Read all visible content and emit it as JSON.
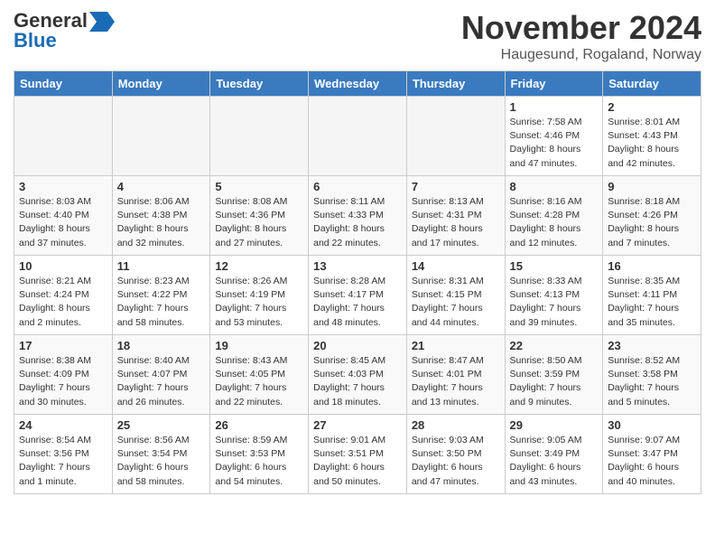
{
  "logo": {
    "line1": "General",
    "line2": "Blue"
  },
  "title": "November 2024",
  "location": "Haugesund, Rogaland, Norway",
  "headers": [
    "Sunday",
    "Monday",
    "Tuesday",
    "Wednesday",
    "Thursday",
    "Friday",
    "Saturday"
  ],
  "weeks": [
    [
      {
        "day": "",
        "info": ""
      },
      {
        "day": "",
        "info": ""
      },
      {
        "day": "",
        "info": ""
      },
      {
        "day": "",
        "info": ""
      },
      {
        "day": "",
        "info": ""
      },
      {
        "day": "1",
        "info": "Sunrise: 7:58 AM\nSunset: 4:46 PM\nDaylight: 8 hours\nand 47 minutes."
      },
      {
        "day": "2",
        "info": "Sunrise: 8:01 AM\nSunset: 4:43 PM\nDaylight: 8 hours\nand 42 minutes."
      }
    ],
    [
      {
        "day": "3",
        "info": "Sunrise: 8:03 AM\nSunset: 4:40 PM\nDaylight: 8 hours\nand 37 minutes."
      },
      {
        "day": "4",
        "info": "Sunrise: 8:06 AM\nSunset: 4:38 PM\nDaylight: 8 hours\nand 32 minutes."
      },
      {
        "day": "5",
        "info": "Sunrise: 8:08 AM\nSunset: 4:36 PM\nDaylight: 8 hours\nand 27 minutes."
      },
      {
        "day": "6",
        "info": "Sunrise: 8:11 AM\nSunset: 4:33 PM\nDaylight: 8 hours\nand 22 minutes."
      },
      {
        "day": "7",
        "info": "Sunrise: 8:13 AM\nSunset: 4:31 PM\nDaylight: 8 hours\nand 17 minutes."
      },
      {
        "day": "8",
        "info": "Sunrise: 8:16 AM\nSunset: 4:28 PM\nDaylight: 8 hours\nand 12 minutes."
      },
      {
        "day": "9",
        "info": "Sunrise: 8:18 AM\nSunset: 4:26 PM\nDaylight: 8 hours\nand 7 minutes."
      }
    ],
    [
      {
        "day": "10",
        "info": "Sunrise: 8:21 AM\nSunset: 4:24 PM\nDaylight: 8 hours\nand 2 minutes."
      },
      {
        "day": "11",
        "info": "Sunrise: 8:23 AM\nSunset: 4:22 PM\nDaylight: 7 hours\nand 58 minutes."
      },
      {
        "day": "12",
        "info": "Sunrise: 8:26 AM\nSunset: 4:19 PM\nDaylight: 7 hours\nand 53 minutes."
      },
      {
        "day": "13",
        "info": "Sunrise: 8:28 AM\nSunset: 4:17 PM\nDaylight: 7 hours\nand 48 minutes."
      },
      {
        "day": "14",
        "info": "Sunrise: 8:31 AM\nSunset: 4:15 PM\nDaylight: 7 hours\nand 44 minutes."
      },
      {
        "day": "15",
        "info": "Sunrise: 8:33 AM\nSunset: 4:13 PM\nDaylight: 7 hours\nand 39 minutes."
      },
      {
        "day": "16",
        "info": "Sunrise: 8:35 AM\nSunset: 4:11 PM\nDaylight: 7 hours\nand 35 minutes."
      }
    ],
    [
      {
        "day": "17",
        "info": "Sunrise: 8:38 AM\nSunset: 4:09 PM\nDaylight: 7 hours\nand 30 minutes."
      },
      {
        "day": "18",
        "info": "Sunrise: 8:40 AM\nSunset: 4:07 PM\nDaylight: 7 hours\nand 26 minutes."
      },
      {
        "day": "19",
        "info": "Sunrise: 8:43 AM\nSunset: 4:05 PM\nDaylight: 7 hours\nand 22 minutes."
      },
      {
        "day": "20",
        "info": "Sunrise: 8:45 AM\nSunset: 4:03 PM\nDaylight: 7 hours\nand 18 minutes."
      },
      {
        "day": "21",
        "info": "Sunrise: 8:47 AM\nSunset: 4:01 PM\nDaylight: 7 hours\nand 13 minutes."
      },
      {
        "day": "22",
        "info": "Sunrise: 8:50 AM\nSunset: 3:59 PM\nDaylight: 7 hours\nand 9 minutes."
      },
      {
        "day": "23",
        "info": "Sunrise: 8:52 AM\nSunset: 3:58 PM\nDaylight: 7 hours\nand 5 minutes."
      }
    ],
    [
      {
        "day": "24",
        "info": "Sunrise: 8:54 AM\nSunset: 3:56 PM\nDaylight: 7 hours\nand 1 minute."
      },
      {
        "day": "25",
        "info": "Sunrise: 8:56 AM\nSunset: 3:54 PM\nDaylight: 6 hours\nand 58 minutes."
      },
      {
        "day": "26",
        "info": "Sunrise: 8:59 AM\nSunset: 3:53 PM\nDaylight: 6 hours\nand 54 minutes."
      },
      {
        "day": "27",
        "info": "Sunrise: 9:01 AM\nSunset: 3:51 PM\nDaylight: 6 hours\nand 50 minutes."
      },
      {
        "day": "28",
        "info": "Sunrise: 9:03 AM\nSunset: 3:50 PM\nDaylight: 6 hours\nand 47 minutes."
      },
      {
        "day": "29",
        "info": "Sunrise: 9:05 AM\nSunset: 3:49 PM\nDaylight: 6 hours\nand 43 minutes."
      },
      {
        "day": "30",
        "info": "Sunrise: 9:07 AM\nSunset: 3:47 PM\nDaylight: 6 hours\nand 40 minutes."
      }
    ]
  ]
}
